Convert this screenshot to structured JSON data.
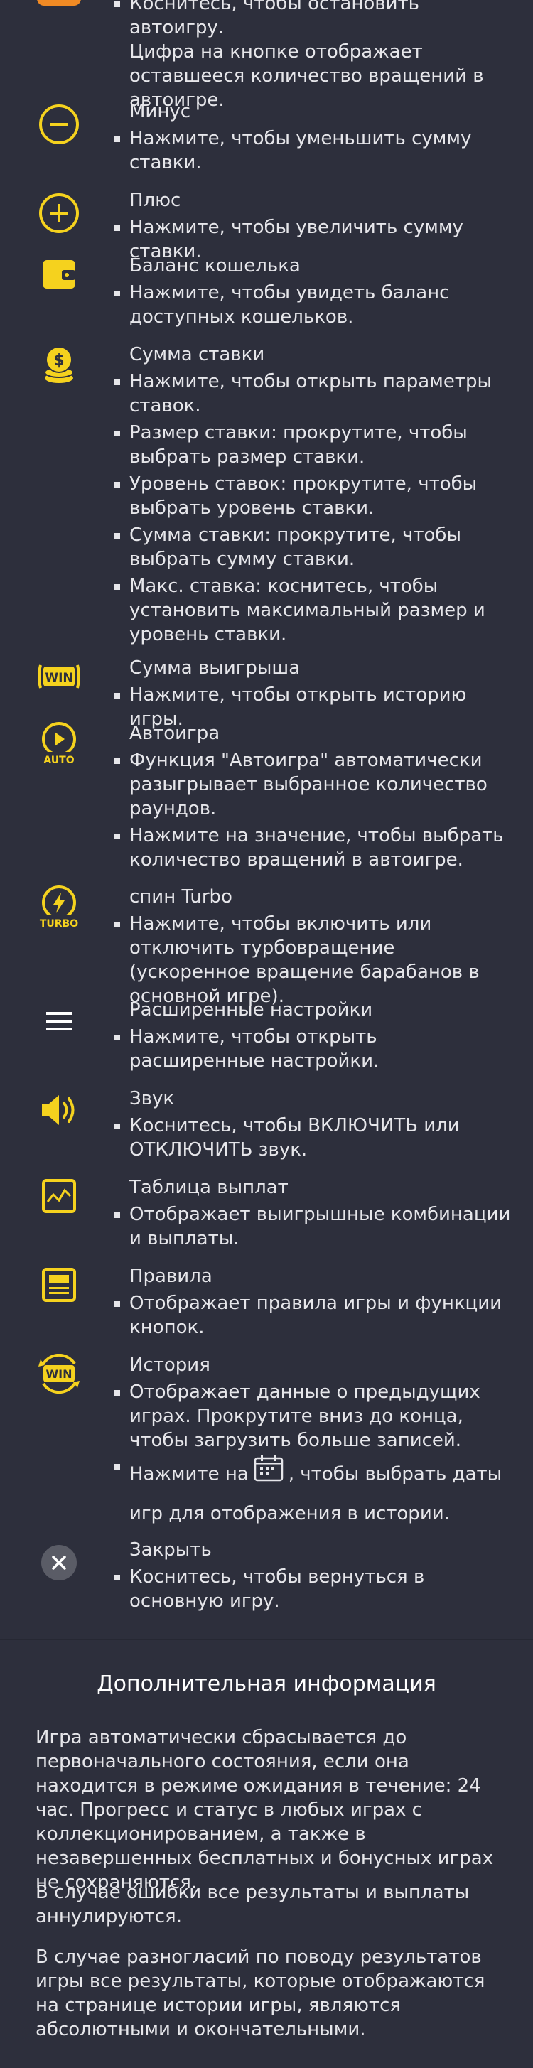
{
  "autoplay_stop": {
    "lines": [
      "Коснитесь, чтобы остановить автоигру.",
      "Цифра на кнопке отображает",
      "оставшееся количество вращений в",
      "автоигре."
    ]
  },
  "items": [
    {
      "title": "Минус",
      "bullets": [
        "Нажмите, чтобы уменьшить сумму ставки."
      ]
    },
    {
      "title": "Плюс",
      "bullets": [
        "Нажмите, чтобы увеличить сумму ставки."
      ]
    },
    {
      "title": "Баланс кошелька",
      "bullets": [
        "Нажмите, чтобы увидеть баланс доступных кошельков."
      ]
    },
    {
      "title": "Сумма ставки",
      "bullets": [
        "Нажмите, чтобы открыть параметры ставок.",
        "Размер ставки: прокрутите, чтобы выбрать размер ставки.",
        "Уровень ставок: прокрутите, чтобы выбрать уровень ставки.",
        "Сумма ставки: прокрутите, чтобы выбрать сумму ставки.",
        "Макс. ставка: коснитесь, чтобы установить максимальный размер и уровень ставки."
      ]
    },
    {
      "title": "Сумма выигрыша",
      "bullets": [
        "Нажмите, чтобы открыть историю игры."
      ]
    },
    {
      "title": "Автоигра",
      "bullets": [
        "Функция \"Автоигра\" автоматически разыгрывает выбранное количество раундов.",
        "Нажмите на значение, чтобы выбрать количество вращений в автоигре."
      ]
    },
    {
      "title": "спин Turbo",
      "bullets": [
        "Нажмите, чтобы включить или отключить турбовращение (ускоренное вращение барабанов в основной игре)."
      ]
    },
    {
      "title": "Расширенные настройки",
      "bullets": [
        "Нажмите, чтобы открыть расширенные настройки."
      ]
    },
    {
      "title": "Звук",
      "bullets": [
        "Коснитесь, чтобы ВКЛЮЧИТЬ или ОТКЛЮЧИТЬ звук."
      ]
    },
    {
      "title": "Таблица выплат",
      "bullets": [
        "Отображает выигрышные комбинации и выплаты."
      ]
    },
    {
      "title": "Правила",
      "bullets": [
        "Отображает правила игры и функции кнопок."
      ]
    },
    {
      "title": "История",
      "bullets": [
        "Отображает данные о предыдущих играх. Прокрутите вниз до конца, чтобы загрузить больше записей."
      ],
      "calendar_prefix": "Нажмите на",
      "calendar_suffix": ", чтобы выбрать даты",
      "calendar_line2": "игр для отображения в истории."
    },
    {
      "title": "Закрыть",
      "bullets": [
        "Коснитесь, чтобы вернуться в основную игру."
      ]
    }
  ],
  "icon_labels": {
    "win": "WIN",
    "auto": "AUTO",
    "turbo": "TURBO"
  },
  "more_info": {
    "title": "Дополнительная информация",
    "paragraphs": [
      "Игра автоматически сбрасывается до первоначального состояния, если она находится в режиме ожидания в течение: 24 час. Прогресс и статус в любых играх с коллекционированием, а также в незавершенных бесплатных и бонусных играх не сохраняются.",
      "В случае ошибки все результаты и выплаты аннулируются.",
      "В случае разногласий по поводу результатов игры все результаты, которые отображаются на странице истории игры, являются абсолютными и окончательными."
    ]
  },
  "colors": {
    "background": "#2d2f3c",
    "accent": "#f5d21e",
    "text": "#e6e6ea",
    "close_circle": "#5a5c66"
  }
}
